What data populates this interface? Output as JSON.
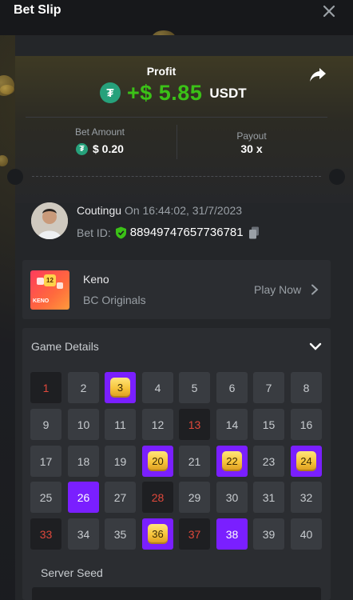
{
  "header": {
    "title": "Bet Slip"
  },
  "summary": {
    "profit_label": "Profit",
    "profit_value": "+$ 5.85",
    "profit_currency": "USDT",
    "bet_amount_label": "Bet Amount",
    "bet_amount_value": "$ 0.20",
    "payout_label": "Payout",
    "payout_value": "30 x"
  },
  "bet": {
    "username": "Coutingu",
    "time": "On 16:44:02, 31/7/2023",
    "bet_id_label": "Bet ID:",
    "bet_id": "88949747657736781"
  },
  "game": {
    "name": "Keno",
    "provider": "BC Originals",
    "play_label": "Play Now",
    "thumb_badge": "12",
    "thumb_text": "KENO"
  },
  "details": {
    "title": "Game Details",
    "tiles": [
      {
        "n": "1",
        "state": "miss"
      },
      {
        "n": "2",
        "state": "normal"
      },
      {
        "n": "3",
        "state": "gold"
      },
      {
        "n": "4",
        "state": "normal"
      },
      {
        "n": "5",
        "state": "normal"
      },
      {
        "n": "6",
        "state": "normal"
      },
      {
        "n": "7",
        "state": "normal"
      },
      {
        "n": "8",
        "state": "normal"
      },
      {
        "n": "9",
        "state": "normal"
      },
      {
        "n": "10",
        "state": "normal"
      },
      {
        "n": "11",
        "state": "normal"
      },
      {
        "n": "12",
        "state": "normal"
      },
      {
        "n": "13",
        "state": "miss"
      },
      {
        "n": "14",
        "state": "normal"
      },
      {
        "n": "15",
        "state": "normal"
      },
      {
        "n": "16",
        "state": "normal"
      },
      {
        "n": "17",
        "state": "normal"
      },
      {
        "n": "18",
        "state": "normal"
      },
      {
        "n": "19",
        "state": "normal"
      },
      {
        "n": "20",
        "state": "gold"
      },
      {
        "n": "21",
        "state": "normal"
      },
      {
        "n": "22",
        "state": "gold"
      },
      {
        "n": "23",
        "state": "normal"
      },
      {
        "n": "24",
        "state": "gold"
      },
      {
        "n": "25",
        "state": "normal"
      },
      {
        "n": "26",
        "state": "hit"
      },
      {
        "n": "27",
        "state": "normal"
      },
      {
        "n": "28",
        "state": "miss"
      },
      {
        "n": "29",
        "state": "normal"
      },
      {
        "n": "30",
        "state": "normal"
      },
      {
        "n": "31",
        "state": "normal"
      },
      {
        "n": "32",
        "state": "normal"
      },
      {
        "n": "33",
        "state": "miss"
      },
      {
        "n": "34",
        "state": "normal"
      },
      {
        "n": "35",
        "state": "normal"
      },
      {
        "n": "36",
        "state": "gold"
      },
      {
        "n": "37",
        "state": "miss"
      },
      {
        "n": "38",
        "state": "hit"
      },
      {
        "n": "39",
        "state": "normal"
      },
      {
        "n": "40",
        "state": "normal"
      }
    ],
    "server_seed_label": "Server Seed"
  },
  "icons": {
    "close": "close-icon",
    "share": "share-icon",
    "tether": "tether-icon",
    "shield": "shield-check-icon",
    "copy": "copy-icon",
    "play_chevron": "chevron-right-icon",
    "details_chevron": "chevron-down-icon"
  },
  "colors": {
    "profit_green": "#3bc117",
    "tether_green": "#26a17b",
    "hit_purple": "#7a1fff",
    "miss_red": "#e0483b",
    "gold": "#f6c33a"
  }
}
